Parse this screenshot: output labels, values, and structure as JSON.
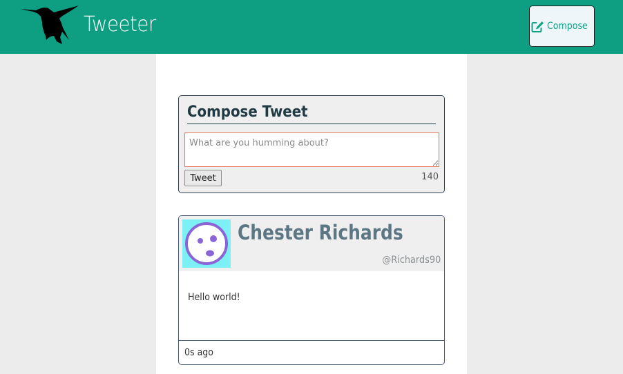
{
  "nav": {
    "brand": "Tweeter",
    "compose_label": "Compose",
    "logo_icon": "hummingbird-logo",
    "compose_icon": "pencil-square-icon",
    "bg_color": "#0e9f83"
  },
  "new_tweet": {
    "title": "Compose Tweet",
    "placeholder": "What are you humming about?",
    "value": "",
    "submit_label": "Tweet",
    "counter": "140"
  },
  "tweets": [
    {
      "name": "Chester Richards",
      "handle": "@Richards90",
      "content": "Hello world!",
      "time": "0s ago",
      "avatar_icon": "face-avatar-icon"
    }
  ]
}
